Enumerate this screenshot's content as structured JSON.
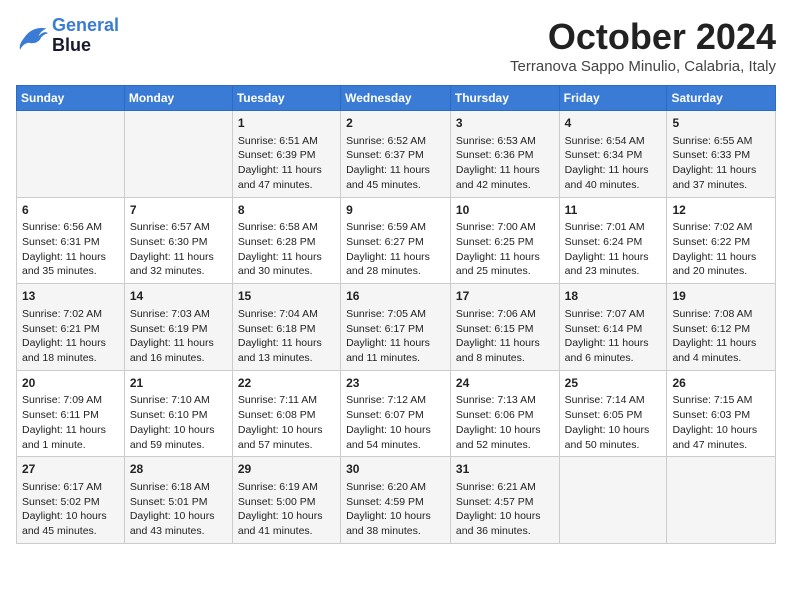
{
  "header": {
    "logo_line1": "General",
    "logo_line2": "Blue",
    "month": "October 2024",
    "location": "Terranova Sappo Minulio, Calabria, Italy"
  },
  "days_of_week": [
    "Sunday",
    "Monday",
    "Tuesday",
    "Wednesday",
    "Thursday",
    "Friday",
    "Saturday"
  ],
  "weeks": [
    [
      {
        "day": "",
        "content": ""
      },
      {
        "day": "",
        "content": ""
      },
      {
        "day": "1",
        "content": "Sunrise: 6:51 AM\nSunset: 6:39 PM\nDaylight: 11 hours and 47 minutes."
      },
      {
        "day": "2",
        "content": "Sunrise: 6:52 AM\nSunset: 6:37 PM\nDaylight: 11 hours and 45 minutes."
      },
      {
        "day": "3",
        "content": "Sunrise: 6:53 AM\nSunset: 6:36 PM\nDaylight: 11 hours and 42 minutes."
      },
      {
        "day": "4",
        "content": "Sunrise: 6:54 AM\nSunset: 6:34 PM\nDaylight: 11 hours and 40 minutes."
      },
      {
        "day": "5",
        "content": "Sunrise: 6:55 AM\nSunset: 6:33 PM\nDaylight: 11 hours and 37 minutes."
      }
    ],
    [
      {
        "day": "6",
        "content": "Sunrise: 6:56 AM\nSunset: 6:31 PM\nDaylight: 11 hours and 35 minutes."
      },
      {
        "day": "7",
        "content": "Sunrise: 6:57 AM\nSunset: 6:30 PM\nDaylight: 11 hours and 32 minutes."
      },
      {
        "day": "8",
        "content": "Sunrise: 6:58 AM\nSunset: 6:28 PM\nDaylight: 11 hours and 30 minutes."
      },
      {
        "day": "9",
        "content": "Sunrise: 6:59 AM\nSunset: 6:27 PM\nDaylight: 11 hours and 28 minutes."
      },
      {
        "day": "10",
        "content": "Sunrise: 7:00 AM\nSunset: 6:25 PM\nDaylight: 11 hours and 25 minutes."
      },
      {
        "day": "11",
        "content": "Sunrise: 7:01 AM\nSunset: 6:24 PM\nDaylight: 11 hours and 23 minutes."
      },
      {
        "day": "12",
        "content": "Sunrise: 7:02 AM\nSunset: 6:22 PM\nDaylight: 11 hours and 20 minutes."
      }
    ],
    [
      {
        "day": "13",
        "content": "Sunrise: 7:02 AM\nSunset: 6:21 PM\nDaylight: 11 hours and 18 minutes."
      },
      {
        "day": "14",
        "content": "Sunrise: 7:03 AM\nSunset: 6:19 PM\nDaylight: 11 hours and 16 minutes."
      },
      {
        "day": "15",
        "content": "Sunrise: 7:04 AM\nSunset: 6:18 PM\nDaylight: 11 hours and 13 minutes."
      },
      {
        "day": "16",
        "content": "Sunrise: 7:05 AM\nSunset: 6:17 PM\nDaylight: 11 hours and 11 minutes."
      },
      {
        "day": "17",
        "content": "Sunrise: 7:06 AM\nSunset: 6:15 PM\nDaylight: 11 hours and 8 minutes."
      },
      {
        "day": "18",
        "content": "Sunrise: 7:07 AM\nSunset: 6:14 PM\nDaylight: 11 hours and 6 minutes."
      },
      {
        "day": "19",
        "content": "Sunrise: 7:08 AM\nSunset: 6:12 PM\nDaylight: 11 hours and 4 minutes."
      }
    ],
    [
      {
        "day": "20",
        "content": "Sunrise: 7:09 AM\nSunset: 6:11 PM\nDaylight: 11 hours and 1 minute."
      },
      {
        "day": "21",
        "content": "Sunrise: 7:10 AM\nSunset: 6:10 PM\nDaylight: 10 hours and 59 minutes."
      },
      {
        "day": "22",
        "content": "Sunrise: 7:11 AM\nSunset: 6:08 PM\nDaylight: 10 hours and 57 minutes."
      },
      {
        "day": "23",
        "content": "Sunrise: 7:12 AM\nSunset: 6:07 PM\nDaylight: 10 hours and 54 minutes."
      },
      {
        "day": "24",
        "content": "Sunrise: 7:13 AM\nSunset: 6:06 PM\nDaylight: 10 hours and 52 minutes."
      },
      {
        "day": "25",
        "content": "Sunrise: 7:14 AM\nSunset: 6:05 PM\nDaylight: 10 hours and 50 minutes."
      },
      {
        "day": "26",
        "content": "Sunrise: 7:15 AM\nSunset: 6:03 PM\nDaylight: 10 hours and 47 minutes."
      }
    ],
    [
      {
        "day": "27",
        "content": "Sunrise: 6:17 AM\nSunset: 5:02 PM\nDaylight: 10 hours and 45 minutes."
      },
      {
        "day": "28",
        "content": "Sunrise: 6:18 AM\nSunset: 5:01 PM\nDaylight: 10 hours and 43 minutes."
      },
      {
        "day": "29",
        "content": "Sunrise: 6:19 AM\nSunset: 5:00 PM\nDaylight: 10 hours and 41 minutes."
      },
      {
        "day": "30",
        "content": "Sunrise: 6:20 AM\nSunset: 4:59 PM\nDaylight: 10 hours and 38 minutes."
      },
      {
        "day": "31",
        "content": "Sunrise: 6:21 AM\nSunset: 4:57 PM\nDaylight: 10 hours and 36 minutes."
      },
      {
        "day": "",
        "content": ""
      },
      {
        "day": "",
        "content": ""
      }
    ]
  ]
}
